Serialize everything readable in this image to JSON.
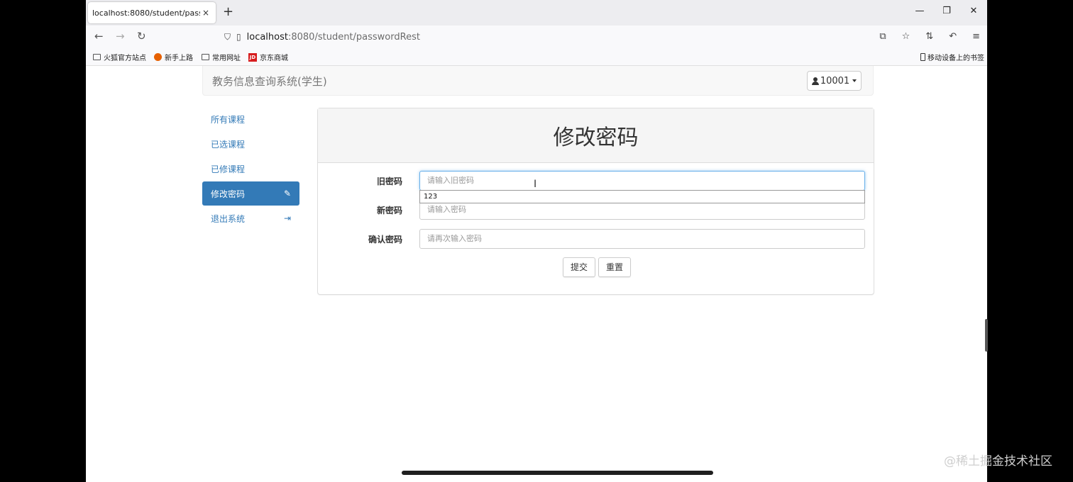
{
  "browser": {
    "tab_title": "localhost:8080/student/passwordRest",
    "tab_close": "×",
    "new_tab": "+",
    "url_host": "localhost",
    "url_rest": ":8080/student/passwordRest",
    "bookmarks": [
      "火狐官方站点",
      "新手上路",
      "常用网址",
      "京东商城"
    ],
    "jd_badge": "JD",
    "mobile_bookmarks": "移动设备上的书签"
  },
  "header": {
    "brand": "教务信息查询系统(学生)",
    "user": "10001"
  },
  "sidebar": {
    "items": [
      {
        "label": "所有课程"
      },
      {
        "label": "已选课程"
      },
      {
        "label": "已修课程"
      },
      {
        "label": "修改密码"
      },
      {
        "label": "退出系统"
      }
    ]
  },
  "panel": {
    "title": "修改密码",
    "fields": [
      {
        "label": "旧密码",
        "placeholder": "请输入旧密码",
        "value": ""
      },
      {
        "label": "新密码",
        "placeholder": "请输入密码",
        "value": ""
      },
      {
        "label": "确认密码",
        "placeholder": "请再次输入密码",
        "value": ""
      }
    ],
    "autocomplete_option": "123",
    "submit_label": "提交",
    "reset_label": "重置"
  },
  "watermark": "@稀土掘金技术社区",
  "colors": {
    "primary": "#337ab7",
    "focus": "#66afe9"
  },
  "icons": {
    "active_item": "pencil-icon",
    "logout": "logout-icon",
    "user": "user-icon"
  }
}
